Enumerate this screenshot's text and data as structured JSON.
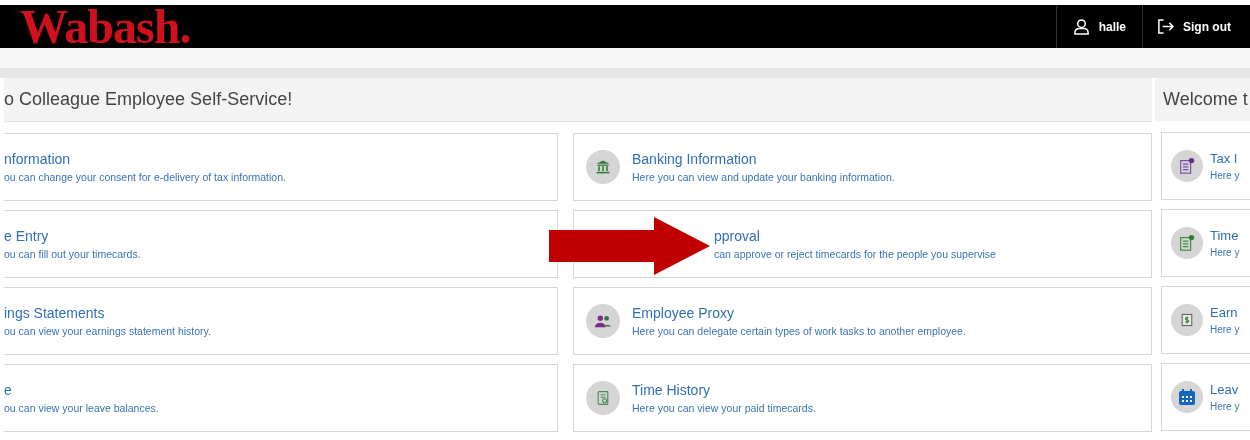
{
  "header": {
    "logo": "Wabash.",
    "user": "halle",
    "sign_out": "Sign out"
  },
  "main_panel": {
    "heading": "o Colleague Employee Self-Service!",
    "cards": [
      {
        "kind": "clipped",
        "title": "nformation",
        "description": "ou can change your consent for e-delivery of tax information."
      },
      {
        "kind": "full",
        "title": "Banking Information",
        "description": "Here you can view and update your banking information."
      },
      {
        "kind": "clipped",
        "title": "e Entry",
        "description": "ou can fill out your timecards."
      },
      {
        "kind": "covered",
        "title": "pproval",
        "description": "can approve or reject timecards for the people you supervise"
      },
      {
        "kind": "clipped",
        "title": "ings Statements",
        "description": "ou can view your earnings statement history."
      },
      {
        "kind": "full",
        "title": "Employee Proxy",
        "description": "Here you can delegate certain types of work tasks to another employee."
      },
      {
        "kind": "clipped",
        "title": "e",
        "description": "ou can view your leave balances."
      },
      {
        "kind": "full",
        "title": "Time History",
        "description": "Here you can view your paid timecards."
      }
    ]
  },
  "side_panel": {
    "heading": "Welcome t",
    "cards": [
      {
        "title": "Tax I",
        "description": "Here y"
      },
      {
        "title": "Time",
        "description": "Here y"
      },
      {
        "title": "Earn",
        "description": "Here y"
      },
      {
        "title": "Leav",
        "description": "Here y"
      }
    ]
  },
  "overlay": {
    "kind": "arrow"
  }
}
